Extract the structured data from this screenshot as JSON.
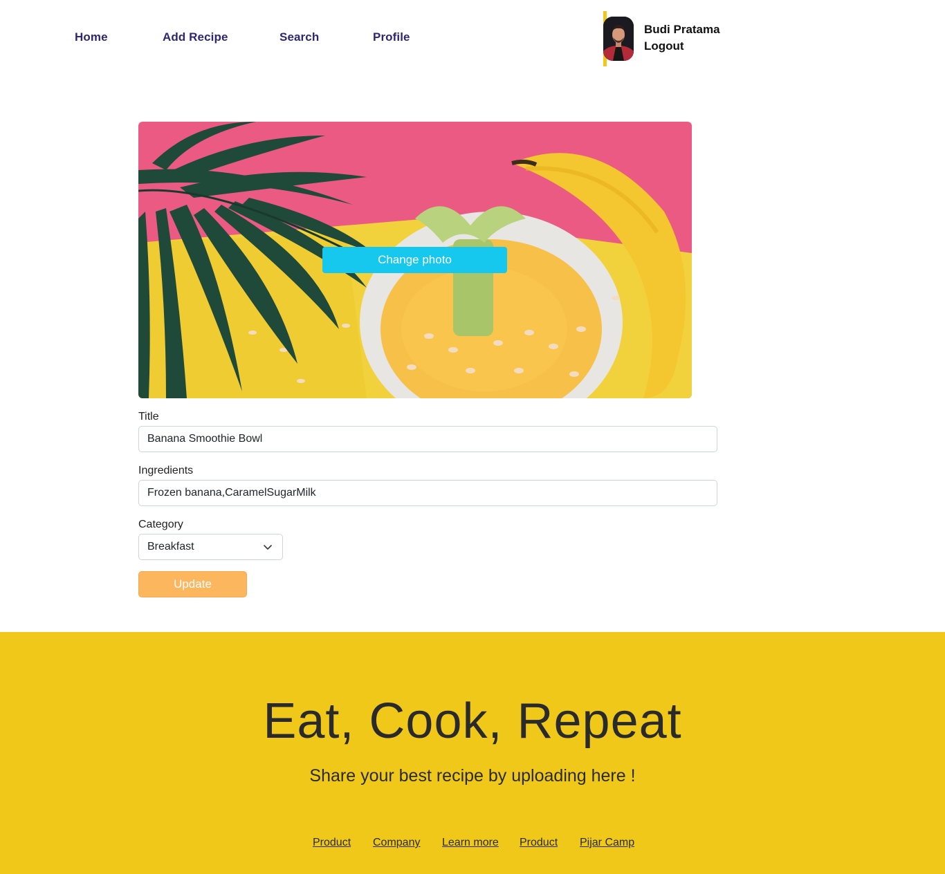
{
  "nav": {
    "links": [
      "Home",
      "Add Recipe",
      "Search",
      "Profile"
    ]
  },
  "user": {
    "name": "Budi Pratama",
    "logout": "Logout"
  },
  "editor": {
    "change_photo": "Change photo",
    "title_label": "Title",
    "title_value": "Banana Smoothie Bowl",
    "ingredients_label": "Ingredients",
    "ingredients_value": "Frozen banana,CaramelSugarMilk",
    "category_label": "Category",
    "category_value": "Breakfast",
    "update_label": "Update"
  },
  "footer": {
    "title": "Eat, Cook, Repeat",
    "subtitle": "Share your best recipe by uploading here !",
    "links": [
      "Product",
      "Company",
      "Learn more",
      "Product",
      "Pijar Camp"
    ]
  },
  "colors": {
    "brand_yellow": "#efc81a",
    "nav_text": "#2e266f",
    "change_photo_button": "#16c8ee",
    "update_button": "#fcb65e"
  }
}
